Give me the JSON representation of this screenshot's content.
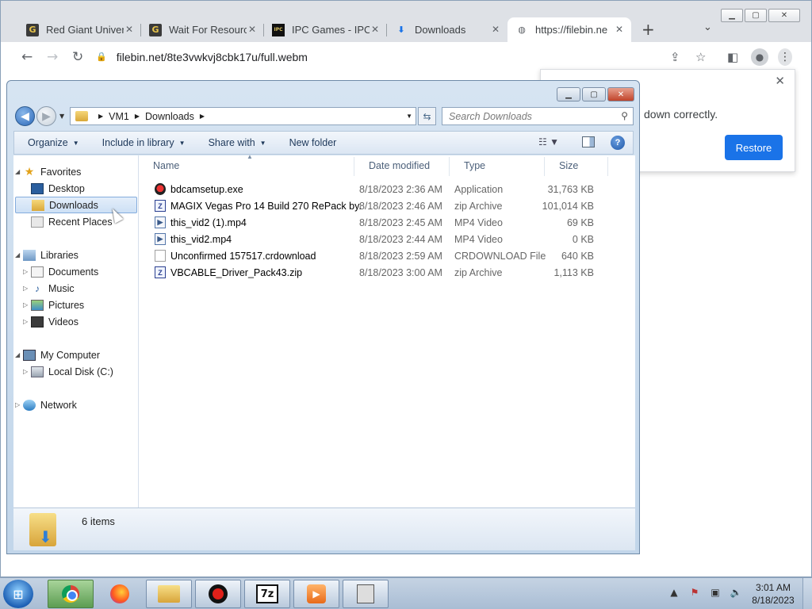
{
  "browser": {
    "tabs": [
      {
        "title": "Red Giant Univer",
        "icon": "G"
      },
      {
        "title": "Wait For Resourc",
        "icon": "G"
      },
      {
        "title": "IPC Games - IPC",
        "icon": "IPC"
      },
      {
        "title": "Downloads",
        "icon": "download-icon"
      },
      {
        "title": "https://filebin.ne",
        "icon": "globe-icon"
      }
    ],
    "url": "filebin.net/8te3vwkvj8cbk17u/full.webm",
    "popup": {
      "message": "down correctly.",
      "button": "Restore"
    }
  },
  "explorer": {
    "breadcrumb": [
      "VM1",
      "Downloads"
    ],
    "search_placeholder": "Search Downloads",
    "commands": [
      "Organize",
      "Include in library",
      "Share with",
      "New folder"
    ],
    "nav": {
      "favorites": {
        "label": "Favorites",
        "items": [
          "Desktop",
          "Downloads",
          "Recent Places"
        ]
      },
      "libraries": {
        "label": "Libraries",
        "items": [
          "Documents",
          "Music",
          "Pictures",
          "Videos"
        ]
      },
      "computer": {
        "label": "My Computer",
        "items": [
          "Local Disk (C:)"
        ]
      },
      "network": {
        "label": "Network"
      }
    },
    "columns": {
      "name": "Name",
      "date": "Date modified",
      "type": "Type",
      "size": "Size"
    },
    "files": [
      {
        "name": "bdcamsetup.exe",
        "date": "8/18/2023 2:36 AM",
        "type": "Application",
        "size": "31,763 KB"
      },
      {
        "name": "MAGIX Vegas Pro 14 Build 270 RePack by...",
        "date": "8/18/2023 2:46 AM",
        "type": "zip Archive",
        "size": "101,014 KB"
      },
      {
        "name": "this_vid2 (1).mp4",
        "date": "8/18/2023 2:45 AM",
        "type": "MP4 Video",
        "size": "69 KB"
      },
      {
        "name": "this_vid2.mp4",
        "date": "8/18/2023 2:44 AM",
        "type": "MP4 Video",
        "size": "0 KB"
      },
      {
        "name": "Unconfirmed 157517.crdownload",
        "date": "8/18/2023 2:59 AM",
        "type": "CRDOWNLOAD File",
        "size": "640 KB"
      },
      {
        "name": "VBCABLE_Driver_Pack43.zip",
        "date": "8/18/2023 3:00 AM",
        "type": "zip Archive",
        "size": "1,113 KB"
      }
    ],
    "status": "6 items"
  },
  "taskbar": {
    "seven_zip_label": "7z",
    "time": "3:01 AM",
    "date": "8/18/2023"
  }
}
